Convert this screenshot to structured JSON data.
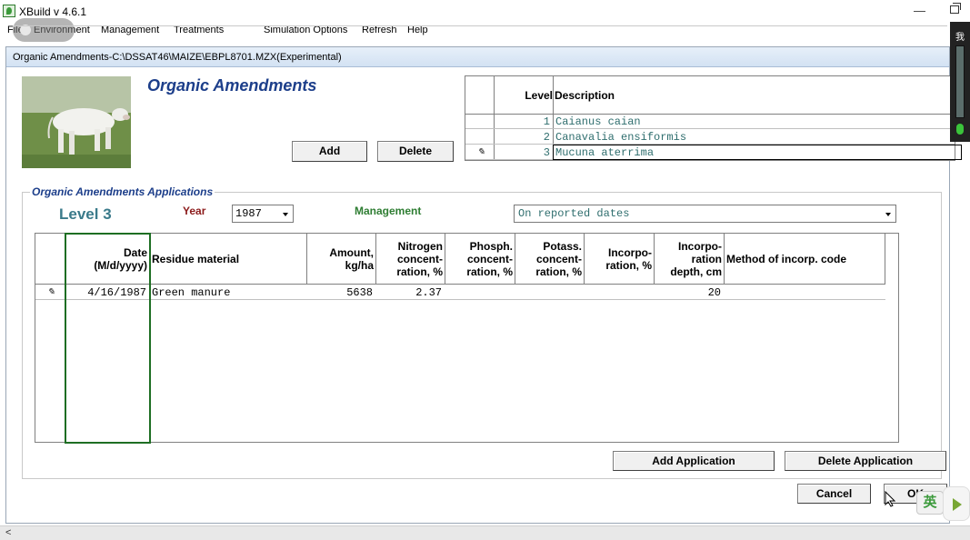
{
  "app": {
    "title": "XBuild v 4.6.1"
  },
  "menu": {
    "items": [
      "File",
      "Environment",
      "Management",
      "Treatments",
      "Simulation Options",
      "Refresh",
      "Help"
    ]
  },
  "child_window": {
    "title": "Organic Amendments-C:\\DSSAT46\\MAIZE\\EBPL8701.MZX(Experimental)"
  },
  "section": {
    "heading": "Organic Amendments",
    "add_label": "Add",
    "delete_label": "Delete"
  },
  "levels_table": {
    "headers": {
      "level": "Level",
      "description": "Description"
    },
    "rows": [
      {
        "level": "1",
        "description": "Caianus caian",
        "selected": false
      },
      {
        "level": "2",
        "description": "Canavalia ensiformis",
        "selected": false
      },
      {
        "level": "3",
        "description": "Mucuna aterrima",
        "selected": true
      }
    ]
  },
  "applications": {
    "legend": "Organic Amendments Applications",
    "level_label": "Level 3",
    "year_label": "Year",
    "year_value": "1987",
    "management_label": "Management",
    "management_value": "On reported dates",
    "headers": [
      "Date (M/d/yyyy)",
      "Residue material",
      "Amount, kg/ha",
      "Nitrogen concent- ration, %",
      "Phosph. concent- ration, %",
      "Potass. concent- ration, %",
      "Incorpo- ration, %",
      "Incorpo- ration depth, cm",
      "Method of incorp. code"
    ],
    "header_lines": {
      "date": [
        "Date",
        "(M/d/yyyy)"
      ],
      "residue": [
        "Residue material"
      ],
      "amount": [
        "Amount,",
        "kg/ha"
      ],
      "nitrogen": [
        "Nitrogen",
        "concent-",
        "ration, %"
      ],
      "phosph": [
        "Phosph.",
        "concent-",
        "ration, %"
      ],
      "potass": [
        "Potass.",
        "concent-",
        "ration, %"
      ],
      "incorp": [
        "Incorpo-",
        "ration, %"
      ],
      "depth": [
        "Incorpo-",
        "ration",
        "depth, cm"
      ],
      "method": [
        "Method of incorp. code"
      ]
    },
    "rows": [
      {
        "date": "4/16/1987",
        "residue": "Green manure",
        "amount": "5638",
        "nitrogen": "2.37",
        "phosph": "",
        "potass": "",
        "incorp": "",
        "depth": "20",
        "method": ""
      }
    ],
    "add_application_label": "Add Application",
    "delete_application_label": "Delete Application"
  },
  "footer": {
    "cancel_label": "Cancel",
    "ok_label": "OK"
  },
  "overlay": {
    "ime_char": "英",
    "side_char": "我"
  },
  "colors": {
    "heading_blue": "#1c3e8a",
    "level_teal": "#3a7a8a",
    "year_red": "#8b1a1a",
    "management_green": "#2e7d32",
    "date_highlight_green": "#1e6e23",
    "data_teal": "#2f6e6e"
  }
}
